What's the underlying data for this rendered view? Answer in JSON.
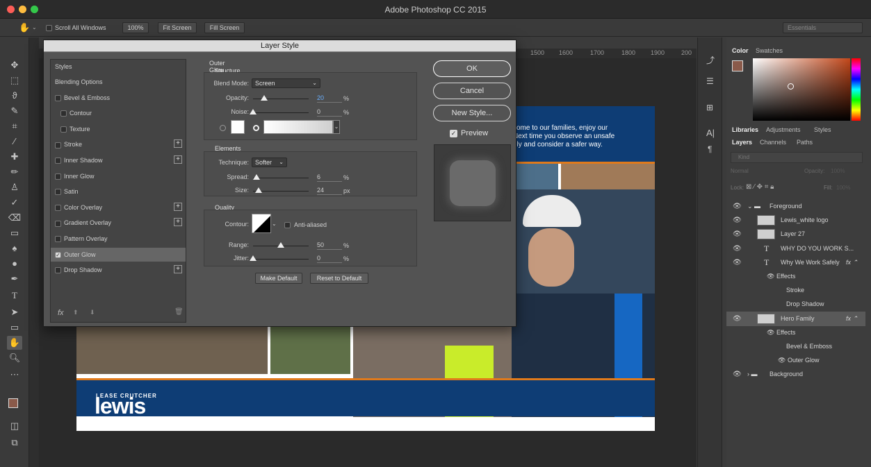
{
  "app": {
    "title": "Adobe Photoshop CC 2015"
  },
  "options_bar": {
    "scroll_all_windows": "Scroll All Windows",
    "zoom_100": "100%",
    "fit_screen": "Fit Screen",
    "fill_screen": "Fill Screen",
    "workspace": "Essentials"
  },
  "ruler": {
    "ticks": [
      "1500",
      "1600",
      "1700",
      "1800",
      "1900",
      "200"
    ]
  },
  "document": {
    "banner_text": [
      "come to our families, enjoy our",
      "Next time you observe an unsafe",
      "ely and consider a safer way."
    ],
    "logo_small": "LEASE CRUTCHER",
    "logo_big": "lewis"
  },
  "dialog": {
    "title": "Layer Style",
    "styles_header": "Styles",
    "styles": [
      {
        "label": "Blending Options",
        "checkbox": false,
        "plus": false,
        "indent": false,
        "active": false
      },
      {
        "label": "Bevel & Emboss",
        "checkbox": true,
        "checked": false,
        "plus": false,
        "indent": false,
        "active": false
      },
      {
        "label": "Contour",
        "checkbox": true,
        "checked": false,
        "plus": false,
        "indent": true,
        "active": false
      },
      {
        "label": "Texture",
        "checkbox": true,
        "checked": false,
        "plus": false,
        "indent": true,
        "active": false
      },
      {
        "label": "Stroke",
        "checkbox": true,
        "checked": false,
        "plus": true,
        "indent": false,
        "active": false
      },
      {
        "label": "Inner Shadow",
        "checkbox": true,
        "checked": false,
        "plus": true,
        "indent": false,
        "active": false
      },
      {
        "label": "Inner Glow",
        "checkbox": true,
        "checked": false,
        "plus": false,
        "indent": false,
        "active": false
      },
      {
        "label": "Satin",
        "checkbox": true,
        "checked": false,
        "plus": false,
        "indent": false,
        "active": false
      },
      {
        "label": "Color Overlay",
        "checkbox": true,
        "checked": false,
        "plus": true,
        "indent": false,
        "active": false
      },
      {
        "label": "Gradient Overlay",
        "checkbox": true,
        "checked": false,
        "plus": true,
        "indent": false,
        "active": false
      },
      {
        "label": "Pattern Overlay",
        "checkbox": true,
        "checked": false,
        "plus": false,
        "indent": false,
        "active": false
      },
      {
        "label": "Outer Glow",
        "checkbox": true,
        "checked": true,
        "plus": false,
        "indent": false,
        "active": true
      },
      {
        "label": "Drop Shadow",
        "checkbox": true,
        "checked": false,
        "plus": true,
        "indent": false,
        "active": false
      }
    ],
    "fx_label": "fx",
    "outer_glow": {
      "title": "Outer Glow",
      "structure": "Structure",
      "blend_mode_label": "Blend Mode:",
      "blend_mode_value": "Screen",
      "opacity_label": "Opacity:",
      "opacity_value": "20",
      "opacity_level": 0.2,
      "noise_label": "Noise:",
      "noise_value": "0",
      "noise_level": 0,
      "percent": "%",
      "px": "px",
      "elements": "Elements",
      "technique_label": "Technique:",
      "technique_value": "Softer",
      "spread_label": "Spread:",
      "spread_value": "6",
      "spread_level": 0.06,
      "size_label": "Size:",
      "size_value": "24",
      "size_level": 0.1,
      "quality": "Quality",
      "contour_label": "Contour:",
      "anti_aliased": "Anti-aliased",
      "range_label": "Range:",
      "range_value": "50",
      "range_level": 0.5,
      "jitter_label": "Jitter:",
      "jitter_value": "0",
      "jitter_level": 0,
      "make_default": "Make Default",
      "reset_default": "Reset to Default"
    },
    "ok": "OK",
    "cancel": "Cancel",
    "new_style": "New Style...",
    "preview": "Preview"
  },
  "color_panel": {
    "tabs": [
      "Color",
      "Swatches"
    ]
  },
  "libraries_tabs": [
    "Libraries",
    "Adjustments",
    "Styles"
  ],
  "layers_panel": {
    "tabs": [
      "Layers",
      "Channels",
      "Paths"
    ],
    "kind": "Kind",
    "blend": "Normal",
    "opacity": "Opacity:",
    "opacity_value": "100%",
    "lock": "Lock:",
    "fill": "Fill:",
    "fill_value": "100%",
    "rows": [
      {
        "label": "Foreground",
        "kind": "group",
        "indent": 0,
        "eye": true
      },
      {
        "label": "Lewis_white logo",
        "kind": "image",
        "indent": 1,
        "eye": true
      },
      {
        "label": "Layer 27",
        "kind": "image",
        "indent": 1,
        "eye": true
      },
      {
        "label": "WHY DO YOU WORK S...",
        "kind": "text",
        "indent": 1,
        "eye": true
      },
      {
        "label": "Why We Work Safely",
        "kind": "text",
        "indent": 1,
        "eye": true,
        "fx": true
      },
      {
        "label": "Effects",
        "kind": "effects",
        "indent": 2,
        "eye": false
      },
      {
        "label": "Stroke",
        "kind": "effect",
        "indent": 3,
        "eye": false
      },
      {
        "label": "Drop Shadow",
        "kind": "effect",
        "indent": 3,
        "eye": false
      },
      {
        "label": "Hero Family",
        "kind": "image",
        "indent": 1,
        "eye": true,
        "fx": true,
        "selected": true
      },
      {
        "label": "Effects",
        "kind": "effects",
        "indent": 2,
        "eye": false
      },
      {
        "label": "Bevel & Emboss",
        "kind": "effect",
        "indent": 3,
        "eye": false
      },
      {
        "label": "Outer Glow",
        "kind": "effect-eye",
        "indent": 3,
        "eye": false
      },
      {
        "label": "Background",
        "kind": "group",
        "indent": 0,
        "eye": true
      }
    ]
  }
}
